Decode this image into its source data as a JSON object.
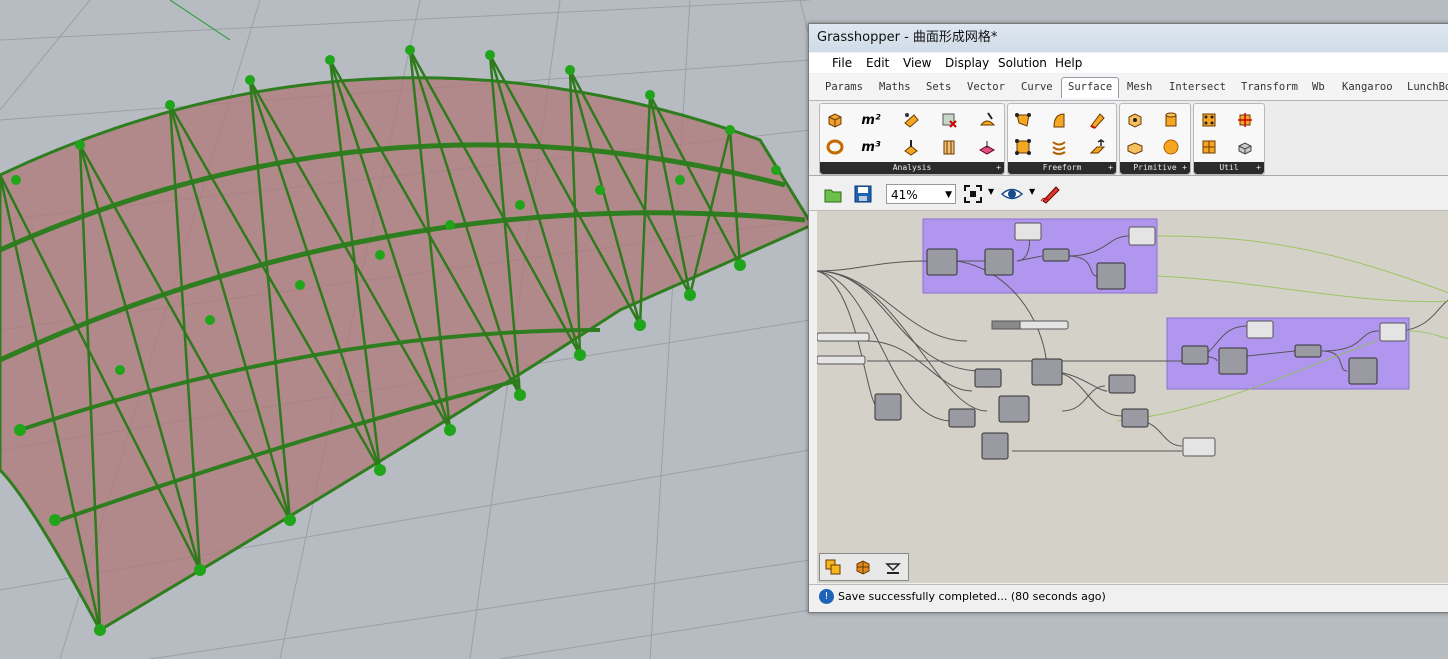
{
  "window": {
    "title": "Grasshopper - 曲面形成网格*"
  },
  "menu": [
    "File",
    "Edit",
    "View",
    "Display",
    "Solution",
    "Help"
  ],
  "tabs": [
    "Params",
    "Maths",
    "Sets",
    "Vector",
    "Curve",
    "Surface",
    "Mesh",
    "Intersect",
    "Transform",
    "Wb",
    "Kangaroo",
    "LunchBo"
  ],
  "active_tab": "Surface",
  "ribbon": {
    "groups": [
      {
        "label": "Analysis",
        "icons": [
          "box-icon",
          "m2-area-icon",
          "point-on-surface-icon",
          "surface-closest-point-icon",
          "shape-pen-icon",
          "torus-icon",
          "m3-volume-icon",
          "evaluate-surface-icon",
          "brep-edges-icon",
          "surface-plane-icon"
        ]
      },
      {
        "label": "Freeform",
        "icons": [
          "surface-from-points-icon",
          "loft-icon",
          "sweep-icon",
          "four-point-surface-icon",
          "network-surface-icon",
          "extrude-icon"
        ]
      },
      {
        "label": "Primitive",
        "icons": [
          "bounding-box-icon",
          "cylinder-icon",
          "box-rectangle-icon",
          "sphere-icon"
        ]
      },
      {
        "label": "Util",
        "icons": [
          "divide-surface-icon",
          "isotrim-icon",
          "surface-grid-icon",
          "brep-join-icon"
        ]
      }
    ],
    "m2_label": "m²",
    "m3_label": "m³"
  },
  "canvas_toolbar": {
    "zoom": "41%"
  },
  "status": {
    "message": "Save successfully completed... (80 seconds ago)"
  },
  "colors": {
    "canvas_bg": "#d4d1c9",
    "group_fill": "#b196f0",
    "grid_line": "#9aa0a6",
    "surface_fill": "#b07878",
    "truss_green": "#2e7d1e",
    "node_green": "#1fa41a"
  }
}
